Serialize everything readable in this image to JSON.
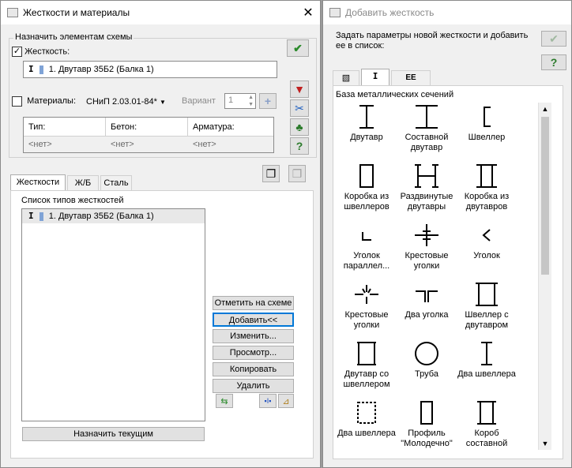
{
  "left": {
    "title": "Жесткости и материалы",
    "assign_label": "Назначить элементам схемы",
    "stiffness_label": "Жесткость:",
    "stiffness_value": "1. Двутавр 35Б2 (Балка 1)",
    "materials_label": "Материалы:",
    "norm_value": "СНиП 2.03.01-84*",
    "variant_label": "Вариант",
    "variant_value": "1",
    "table_headers": [
      "Тип:",
      "Бетон:",
      "Арматура:"
    ],
    "table_values": [
      "<нет>",
      "<нет>",
      "<нет>"
    ],
    "tabs": [
      "Жесткости",
      "Ж/Б",
      "Сталь"
    ],
    "list_title": "Список типов жесткостей",
    "list_items": [
      "1. Двутавр 35Б2 (Балка 1)"
    ],
    "buttons": [
      "Отметить на схеме",
      "Добавить<<",
      "Изменить...",
      "Просмотр...",
      "Копировать",
      "Удалить"
    ],
    "assign_current": "Назначить текущим"
  },
  "right": {
    "title": "Добавить жесткость",
    "description": "Задать параметры новой жесткости и добавить ее в список:",
    "db_label": "База металлических сечений",
    "items": [
      {
        "label": "Двутавр",
        "icon": "i-beam-icon"
      },
      {
        "label": "Составной двутавр",
        "icon": "composite-i-beam-icon"
      },
      {
        "label": "Швеллер",
        "icon": "channel-icon"
      },
      {
        "label": "Коробка из швеллеров",
        "icon": "channel-box-icon"
      },
      {
        "label": "Раздвинутые двутавры",
        "icon": "spread-i-beams-icon"
      },
      {
        "label": "Коробка из двутавров",
        "icon": "i-beam-box-icon"
      },
      {
        "label": "Уголок параллел...",
        "icon": "angle-parallel-icon"
      },
      {
        "label": "Крестовые уголки",
        "icon": "cross-angles-icon"
      },
      {
        "label": "Уголок",
        "icon": "angle-icon"
      },
      {
        "label": "Крестовые уголки",
        "icon": "cross-angles-2-icon"
      },
      {
        "label": "Два уголка",
        "icon": "two-angles-icon"
      },
      {
        "label": "Швеллер с двутавром",
        "icon": "channel-with-i-beam-icon"
      },
      {
        "label": "Двутавр со швеллером",
        "icon": "i-beam-with-channel-icon"
      },
      {
        "label": "Труба",
        "icon": "pipe-icon"
      },
      {
        "label": "Два швеллера",
        "icon": "two-channels-icon"
      },
      {
        "label": "Два швеллера",
        "icon": "two-channels-box-icon"
      },
      {
        "label": "Профиль \"Молодечно\"",
        "icon": "molodechno-profile-icon"
      },
      {
        "label": "Короб составной",
        "icon": "composite-box-icon"
      }
    ]
  }
}
